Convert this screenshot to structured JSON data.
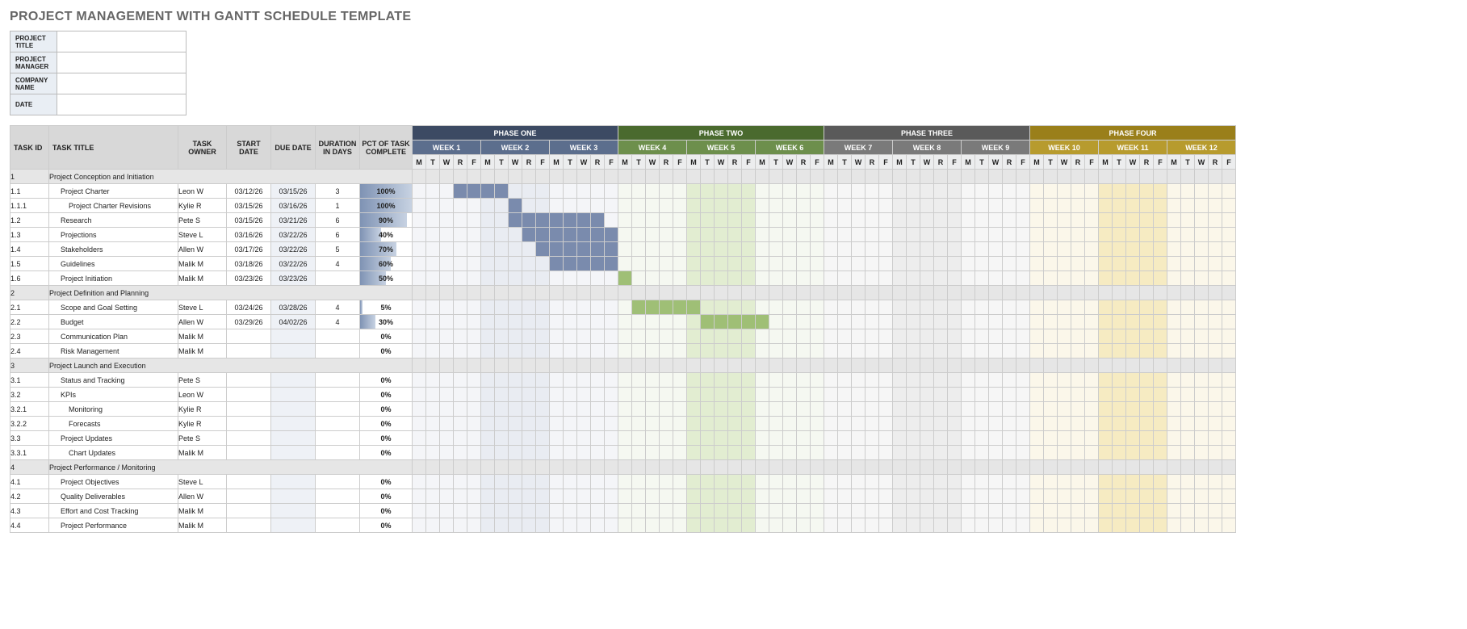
{
  "page_title": "PROJECT MANAGEMENT WITH GANTT SCHEDULE TEMPLATE",
  "info_labels": [
    "PROJECT TITLE",
    "PROJECT MANAGER",
    "COMPANY NAME",
    "DATE"
  ],
  "info_values": [
    "",
    "",
    "",
    ""
  ],
  "headers": {
    "id": "TASK ID",
    "title": "TASK TITLE",
    "owner": "TASK OWNER",
    "start": "START DATE",
    "due": "DUE DATE",
    "dur": "DURATION IN DAYS",
    "pct": "PCT OF TASK COMPLETE"
  },
  "phases": [
    {
      "label": "PHASE ONE",
      "weeks": [
        "WEEK 1",
        "WEEK 2",
        "WEEK 3"
      ],
      "bg": "#3c4a63",
      "week_bg": "#5c6e8d",
      "tl_bg": "#f4f5f8",
      "tl_alt": "#e9ecf2",
      "bar": "#7a8bad"
    },
    {
      "label": "PHASE TWO",
      "weeks": [
        "WEEK 4",
        "WEEK 5",
        "WEEK 6"
      ],
      "bg": "#4a6a2e",
      "week_bg": "#6d8f4c",
      "tl_bg": "#f5f8f1",
      "tl_alt": "#ebf1e3",
      "bar": "#9fbf76"
    },
    {
      "label": "PHASE THREE",
      "weeks": [
        "WEEK 7",
        "WEEK 8",
        "WEEK 9"
      ],
      "bg": "#5a5a5a",
      "week_bg": "#7a7a7a",
      "tl_bg": "#f6f6f6",
      "tl_alt": "#ededed",
      "bar": "#a8a8a8"
    },
    {
      "label": "PHASE FOUR",
      "weeks": [
        "WEEK 10",
        "WEEK 11",
        "WEEK 12"
      ],
      "bg": "#9a7f1a",
      "week_bg": "#b79b2e",
      "tl_bg": "#fbf7ea",
      "tl_alt": "#f5eed6",
      "bar": "#d6c06a"
    }
  ],
  "days": [
    "M",
    "T",
    "W",
    "R",
    "F"
  ],
  "tasks": [
    {
      "id": "1",
      "title": "Project Conception and Initiation",
      "section": true
    },
    {
      "id": "1.1",
      "title": "Project Charter",
      "owner": "Leon W",
      "start": "03/12/26",
      "due": "03/15/26",
      "dur": "3",
      "pct": 100,
      "indent": 1,
      "bar_start": 3,
      "bar_len": 4
    },
    {
      "id": "1.1.1",
      "title": "Project Charter Revisions",
      "owner": "Kylie R",
      "start": "03/15/26",
      "due": "03/16/26",
      "dur": "1",
      "pct": 100,
      "indent": 2,
      "bar_start": 7,
      "bar_len": 1
    },
    {
      "id": "1.2",
      "title": "Research",
      "owner": "Pete S",
      "start": "03/15/26",
      "due": "03/21/26",
      "dur": "6",
      "pct": 90,
      "indent": 1,
      "bar_start": 7,
      "bar_len": 7
    },
    {
      "id": "1.3",
      "title": "Projections",
      "owner": "Steve L",
      "start": "03/16/26",
      "due": "03/22/26",
      "dur": "6",
      "pct": 40,
      "indent": 1,
      "bar_start": 8,
      "bar_len": 7
    },
    {
      "id": "1.4",
      "title": "Stakeholders",
      "owner": "Allen W",
      "start": "03/17/26",
      "due": "03/22/26",
      "dur": "5",
      "pct": 70,
      "indent": 1,
      "bar_start": 9,
      "bar_len": 6
    },
    {
      "id": "1.5",
      "title": "Guidelines",
      "owner": "Malik M",
      "start": "03/18/26",
      "due": "03/22/26",
      "dur": "4",
      "pct": 60,
      "indent": 1,
      "bar_start": 10,
      "bar_len": 5
    },
    {
      "id": "1.6",
      "title": "Project Initiation",
      "owner": "Malik M",
      "start": "03/23/26",
      "due": "03/23/26",
      "dur": "",
      "pct": 50,
      "indent": 1,
      "bar_start": 15,
      "bar_len": 1
    },
    {
      "id": "2",
      "title": "Project Definition and Planning",
      "section": true
    },
    {
      "id": "2.1",
      "title": "Scope and Goal Setting",
      "owner": "Steve L",
      "start": "03/24/26",
      "due": "03/28/26",
      "dur": "4",
      "pct": 5,
      "indent": 1,
      "bar_start": 16,
      "bar_len": 5
    },
    {
      "id": "2.2",
      "title": "Budget",
      "owner": "Allen W",
      "start": "03/29/26",
      "due": "04/02/26",
      "dur": "4",
      "pct": 30,
      "indent": 1,
      "bar_start": 21,
      "bar_len": 5
    },
    {
      "id": "2.3",
      "title": "Communication Plan",
      "owner": "Malik M",
      "start": "",
      "due": "",
      "dur": "",
      "pct": 0,
      "indent": 1
    },
    {
      "id": "2.4",
      "title": "Risk Management",
      "owner": "Malik M",
      "start": "",
      "due": "",
      "dur": "",
      "pct": 0,
      "indent": 1
    },
    {
      "id": "3",
      "title": "Project Launch and Execution",
      "section": true
    },
    {
      "id": "3.1",
      "title": "Status and Tracking",
      "owner": "Pete S",
      "start": "",
      "due": "",
      "dur": "",
      "pct": 0,
      "indent": 1
    },
    {
      "id": "3.2",
      "title": "KPIs",
      "owner": "Leon W",
      "start": "",
      "due": "",
      "dur": "",
      "pct": 0,
      "indent": 1
    },
    {
      "id": "3.2.1",
      "title": "Monitoring",
      "owner": "Kylie R",
      "start": "",
      "due": "",
      "dur": "",
      "pct": 0,
      "indent": 2
    },
    {
      "id": "3.2.2",
      "title": "Forecasts",
      "owner": "Kylie R",
      "start": "",
      "due": "",
      "dur": "",
      "pct": 0,
      "indent": 2
    },
    {
      "id": "3.3",
      "title": "Project Updates",
      "owner": "Pete S",
      "start": "",
      "due": "",
      "dur": "",
      "pct": 0,
      "indent": 1
    },
    {
      "id": "3.3.1",
      "title": "Chart Updates",
      "owner": "Malik M",
      "start": "",
      "due": "",
      "dur": "",
      "pct": 0,
      "indent": 2
    },
    {
      "id": "4",
      "title": "Project Performance / Monitoring",
      "section": true
    },
    {
      "id": "4.1",
      "title": "Project Objectives",
      "owner": "Steve L",
      "start": "",
      "due": "",
      "dur": "",
      "pct": 0,
      "indent": 1
    },
    {
      "id": "4.2",
      "title": "Quality Deliverables",
      "owner": "Allen W",
      "start": "",
      "due": "",
      "dur": "",
      "pct": 0,
      "indent": 1
    },
    {
      "id": "4.3",
      "title": "Effort and Cost Tracking",
      "owner": "Malik M",
      "start": "",
      "due": "",
      "dur": "",
      "pct": 0,
      "indent": 1
    },
    {
      "id": "4.4",
      "title": "Project Performance",
      "owner": "Malik M",
      "start": "",
      "due": "",
      "dur": "",
      "pct": 0,
      "indent": 1
    }
  ],
  "day_highlights": {
    "1": {
      "cols": [
        20,
        21,
        22,
        23,
        24
      ],
      "bg": "#e2edd1"
    },
    "3": {
      "cols": [
        50,
        51,
        52,
        53,
        54
      ],
      "bg": "#f6ebc2"
    }
  }
}
